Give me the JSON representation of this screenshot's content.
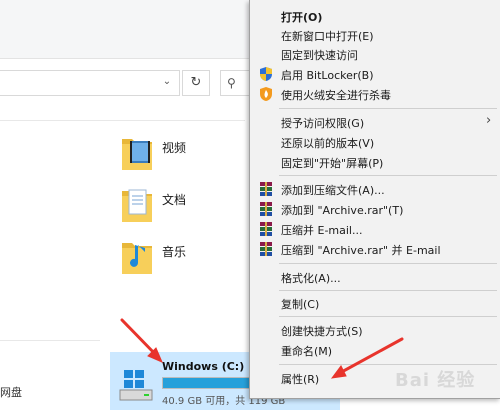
{
  "explorer": {
    "search_placeholder": "",
    "folders": [
      {
        "label": "视频",
        "icon": "video-folder-icon"
      },
      {
        "label": "文档",
        "icon": "documents-folder-icon"
      },
      {
        "label": "音乐",
        "icon": "music-folder-icon"
      }
    ],
    "network_label": "网盘",
    "drive": {
      "name": "Windows (C:)",
      "free_text": "40.9 GB 可用，共 119 GB",
      "used_fraction": 0.66,
      "icon": "windows-drive-icon"
    }
  },
  "context_menu": {
    "items": [
      {
        "label": "打开(O)",
        "bold": true
      },
      {
        "label": "在新窗口中打开(E)"
      },
      {
        "label": "固定到快速访问"
      },
      {
        "label": "启用 BitLocker(B)",
        "icon": "shield-icon"
      },
      {
        "label": "使用火绒安全进行杀毒",
        "icon": "huorong-icon"
      },
      {
        "label": "授予访问权限(G)",
        "submenu": true
      },
      {
        "label": "还原以前的版本(V)"
      },
      {
        "label": "固定到\"开始\"屏幕(P)"
      },
      {
        "label": "添加到压缩文件(A)...",
        "icon": "winrar-icon"
      },
      {
        "label": "添加到 \"Archive.rar\"(T)",
        "icon": "winrar-icon"
      },
      {
        "label": "压缩并 E-mail...",
        "icon": "winrar-icon"
      },
      {
        "label": "压缩到 \"Archive.rar\" 并 E-mail",
        "icon": "winrar-icon"
      },
      {
        "label": "格式化(A)..."
      },
      {
        "label": "复制(C)"
      },
      {
        "label": "创建快捷方式(S)"
      },
      {
        "label": "重命名(M)"
      },
      {
        "label": "属性(R)"
      }
    ],
    "submenu_arrow": "›"
  },
  "watermark": "Bai 经验",
  "colors": {
    "annotation": "#e8342c",
    "selection": "#cce8ff",
    "progress": "#26a0da"
  }
}
